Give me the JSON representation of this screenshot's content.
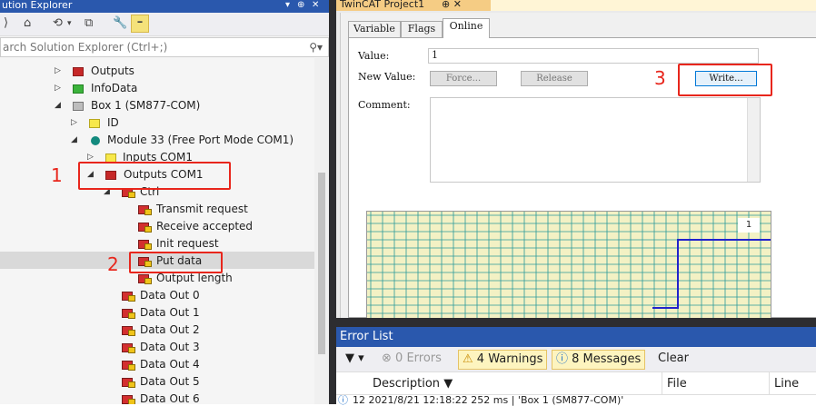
{
  "solution_explorer": {
    "title": "ution Explorer",
    "search_placeholder": "arch Solution Explorer (Ctrl+;)",
    "tree": [
      {
        "label": "Outputs",
        "icon": "red"
      },
      {
        "label": "InfoData",
        "icon": "green"
      },
      {
        "label": "Box 1 (SM877-COM)",
        "icon": "gray"
      },
      {
        "label": "ID",
        "icon": "yellow"
      },
      {
        "label": "Module 33 (Free Port Mode COM1)",
        "icon": "teal"
      },
      {
        "label": "Inputs COM1",
        "icon": "yellow"
      },
      {
        "label": "Outputs COM1",
        "icon": "red"
      },
      {
        "label": "Ctrl",
        "icon": "var"
      },
      {
        "label": "Transmit request",
        "icon": "var"
      },
      {
        "label": "Receive accepted",
        "icon": "var"
      },
      {
        "label": "Init request",
        "icon": "var"
      },
      {
        "label": "Put data",
        "icon": "var"
      },
      {
        "label": "Output length",
        "icon": "var"
      },
      {
        "label": "Data Out 0",
        "icon": "var"
      },
      {
        "label": "Data Out 1",
        "icon": "var"
      },
      {
        "label": "Data Out 2",
        "icon": "var"
      },
      {
        "label": "Data Out 3",
        "icon": "var"
      },
      {
        "label": "Data Out 4",
        "icon": "var"
      },
      {
        "label": "Data Out 5",
        "icon": "var"
      },
      {
        "label": "Data Out 6",
        "icon": "var"
      }
    ]
  },
  "annotations": [
    "1",
    "2",
    "3"
  ],
  "twincat": {
    "tab_title": "TwinCAT Project1",
    "tab_controls": "⊕ ✕",
    "tabs": [
      "Variable",
      "Flags",
      "Online"
    ],
    "value_label": "Value:",
    "value": "1",
    "new_value_label": "New Value:",
    "force_button": "Force...",
    "release_button": "Release",
    "write_button": "Write...",
    "comment_label": "Comment:",
    "scope_label": "1"
  },
  "error_list": {
    "title": "Error List",
    "errors": "0 Errors",
    "warnings": "4 Warnings",
    "messages": "8 Messages",
    "clear": "Clear",
    "col_description": "Description",
    "col_file": "File",
    "col_line": "Line",
    "row_text": "12 2021/8/21 12:18:22 252 ms | 'Box 1 (SM877-COM)'"
  },
  "colors": {
    "accent_blue": "#2a58ad",
    "annotation_red": "#e8261c",
    "scope_background": "#f3f1c4",
    "scope_grid": "#2a9a9a",
    "scope_signal": "#2222cc"
  }
}
